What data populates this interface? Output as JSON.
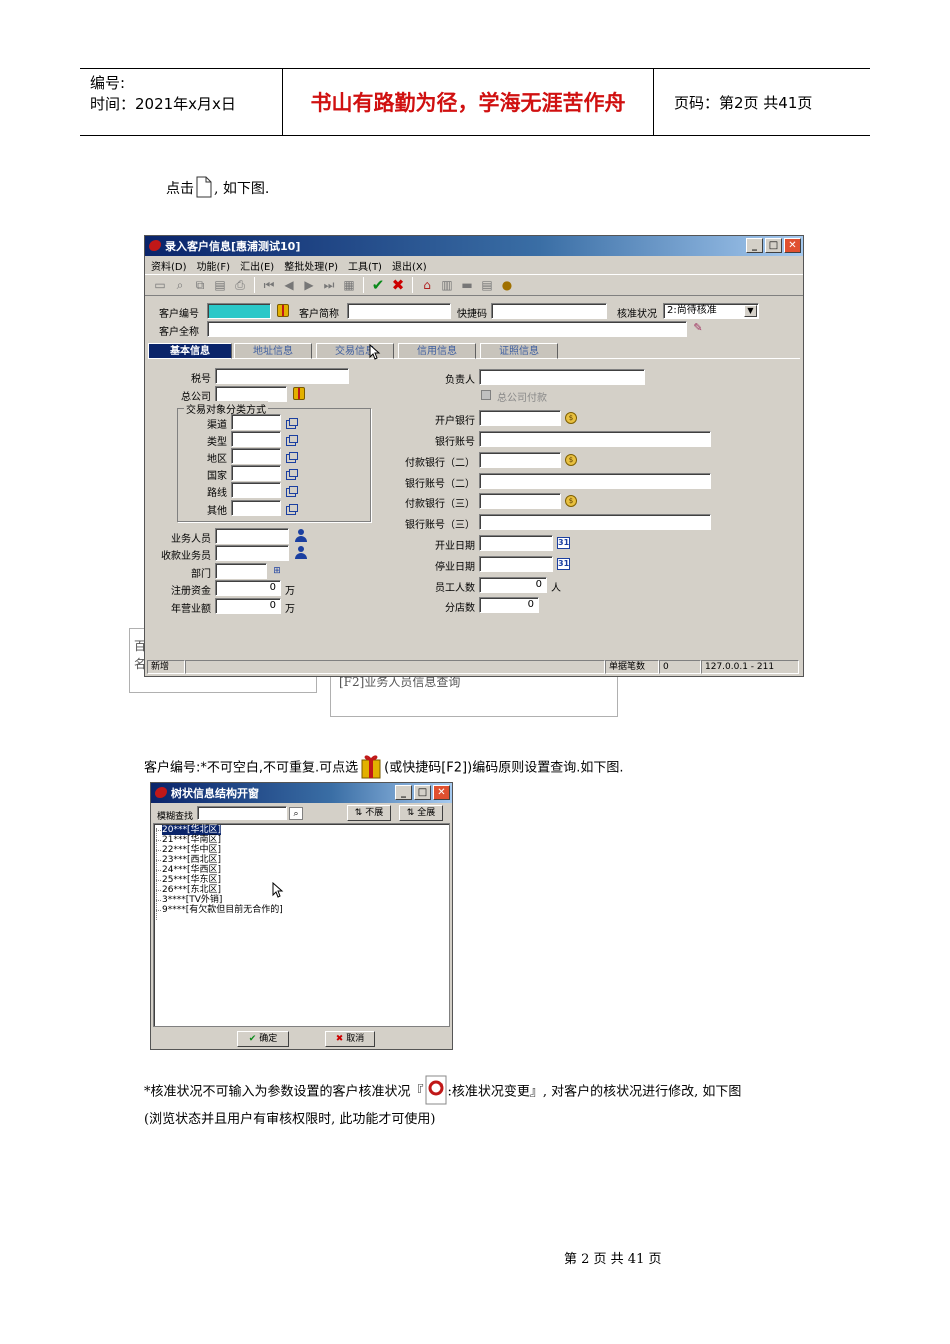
{
  "header": {
    "number_label": "编号:",
    "time_label": "时间：2021年x月x日",
    "motto": "书山有路勤为径，学海无涯苦作舟",
    "page_label": "页码：第2页  共41页"
  },
  "intro": {
    "before": "点击",
    "after": ", 如下图."
  },
  "main_window": {
    "title": "录入客户信息[惠浦测试10]",
    "menu": [
      "资料(D)",
      "功能(F)",
      "汇出(E)",
      "整批处理(P)",
      "工具(T)",
      "退出(X)"
    ],
    "fields": {
      "customer_no": "客户编号",
      "short_name": "客户简称",
      "quick_code": "快捷码",
      "approval_status": "核准状况",
      "approval_value": "2:尚待核准",
      "full_name": "客户全称"
    },
    "tabs": [
      "基本信息",
      "地址信息",
      "交易信息",
      "信用信息",
      "证照信息"
    ],
    "left": {
      "tax_no": "税号",
      "head_office": "总公司",
      "group_title": "交易对象分类方式",
      "classes": [
        "渠道",
        "类型",
        "地区",
        "国家",
        "路线",
        "其他"
      ],
      "salesperson": "业务人员",
      "collector": "收款业务员",
      "department": "部门",
      "reg_capital": "注册资金",
      "reg_capital_value": "0",
      "annual_revenue": "年营业额",
      "annual_revenue_value": "0",
      "unit": "万"
    },
    "right": {
      "responsible": "负责人",
      "hq_pay": "总公司付款",
      "bank": "开户银行",
      "account": "银行账号",
      "bank2": "付款银行（二）",
      "account2": "银行账号（二）",
      "bank3": "付款银行（三）",
      "account3": "银行账号（三）",
      "open_date": "开业日期",
      "close_date": "停业日期",
      "employees": "员工人数",
      "employees_value": "0",
      "employees_unit": "人",
      "branches": "分店数",
      "branches_value": "0"
    },
    "status": {
      "mode": "新增",
      "count_label": "单据笔数",
      "count": "0",
      "server": "127.0.0.1 - 211"
    }
  },
  "ghost": {
    "line1": "[F2]业务人员信息查询",
    "left_a": "百",
    "left_b": "名"
  },
  "para2": {
    "before": "客户编号:*不可空白,不可重复.可点选",
    "after": "(或快捷码[F2])编码原则设置查询.如下图."
  },
  "tree_window": {
    "title": "树状信息结构开窗",
    "search_label": "模糊查找",
    "collapse": "不展",
    "expand": "全展",
    "nodes": [
      "20***[华北区]",
      "21***[华南区]",
      "22***[华中区]",
      "23***[西北区]",
      "24***[华西区]",
      "25***[华东区]",
      "26***[东北区]",
      "3****[TV外销]",
      "9****[有欠款但目前无合作的]"
    ],
    "ok": "确定",
    "cancel": "取消"
  },
  "para3": {
    "before": "*核准状况不可输入为参数设置的客户核准状况『",
    "after": ":核准状况变更』, 对客户的核状况进行修改, 如下图",
    "line2": "(浏览状态并且用户有审核权限时, 此功能才可使用)"
  },
  "footer": "第 2 页 共 41 页"
}
